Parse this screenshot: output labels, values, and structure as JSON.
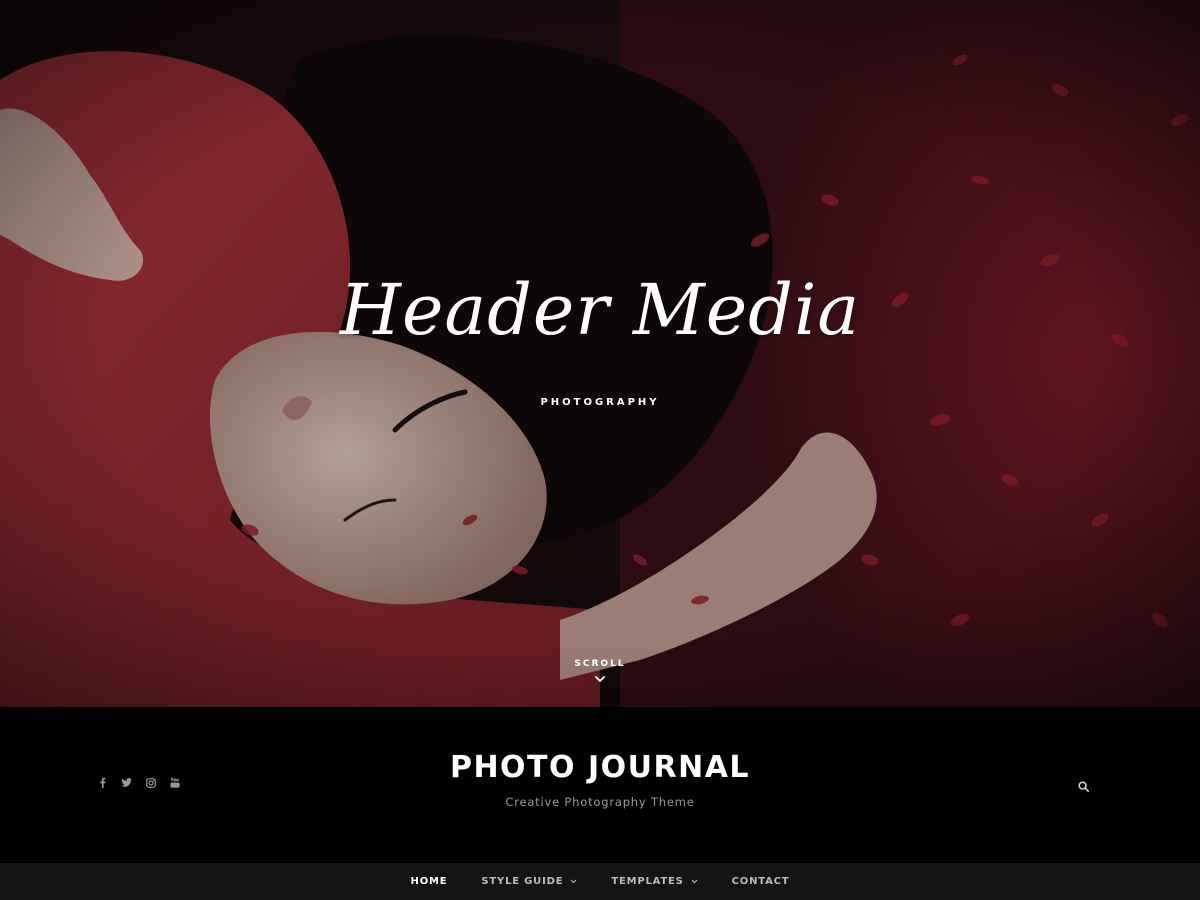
{
  "hero": {
    "title": "Header Media",
    "subtitle": "PHOTOGRAPHY",
    "scroll_label": "SCROLL",
    "scroll_icon": "chevron-down-icon",
    "image_description_colors": {
      "sweater": "#a8323a",
      "foliage": "#8e1f2c",
      "hair": "#140c0d",
      "skin": "#d9b9ac"
    }
  },
  "header": {
    "site_title": "PHOTO JOURNAL",
    "tagline": "Creative Photography Theme",
    "social": [
      {
        "name": "facebook",
        "icon": "facebook-icon"
      },
      {
        "name": "twitter",
        "icon": "twitter-icon"
      },
      {
        "name": "instagram",
        "icon": "instagram-icon"
      },
      {
        "name": "youtube",
        "icon": "youtube-icon"
      }
    ],
    "search_icon": "search-icon"
  },
  "nav": {
    "items": [
      {
        "label": "HOME",
        "active": true,
        "has_submenu": false
      },
      {
        "label": "STYLE GUIDE",
        "active": false,
        "has_submenu": true
      },
      {
        "label": "TEMPLATES",
        "active": false,
        "has_submenu": true
      },
      {
        "label": "CONTACT",
        "active": false,
        "has_submenu": false
      }
    ]
  },
  "colors": {
    "masthead_bg": "#000000",
    "nav_bg": "#141414",
    "nav_text": "#bdbdbd",
    "nav_active": "#ffffff",
    "tagline": "#9a9a9a"
  }
}
